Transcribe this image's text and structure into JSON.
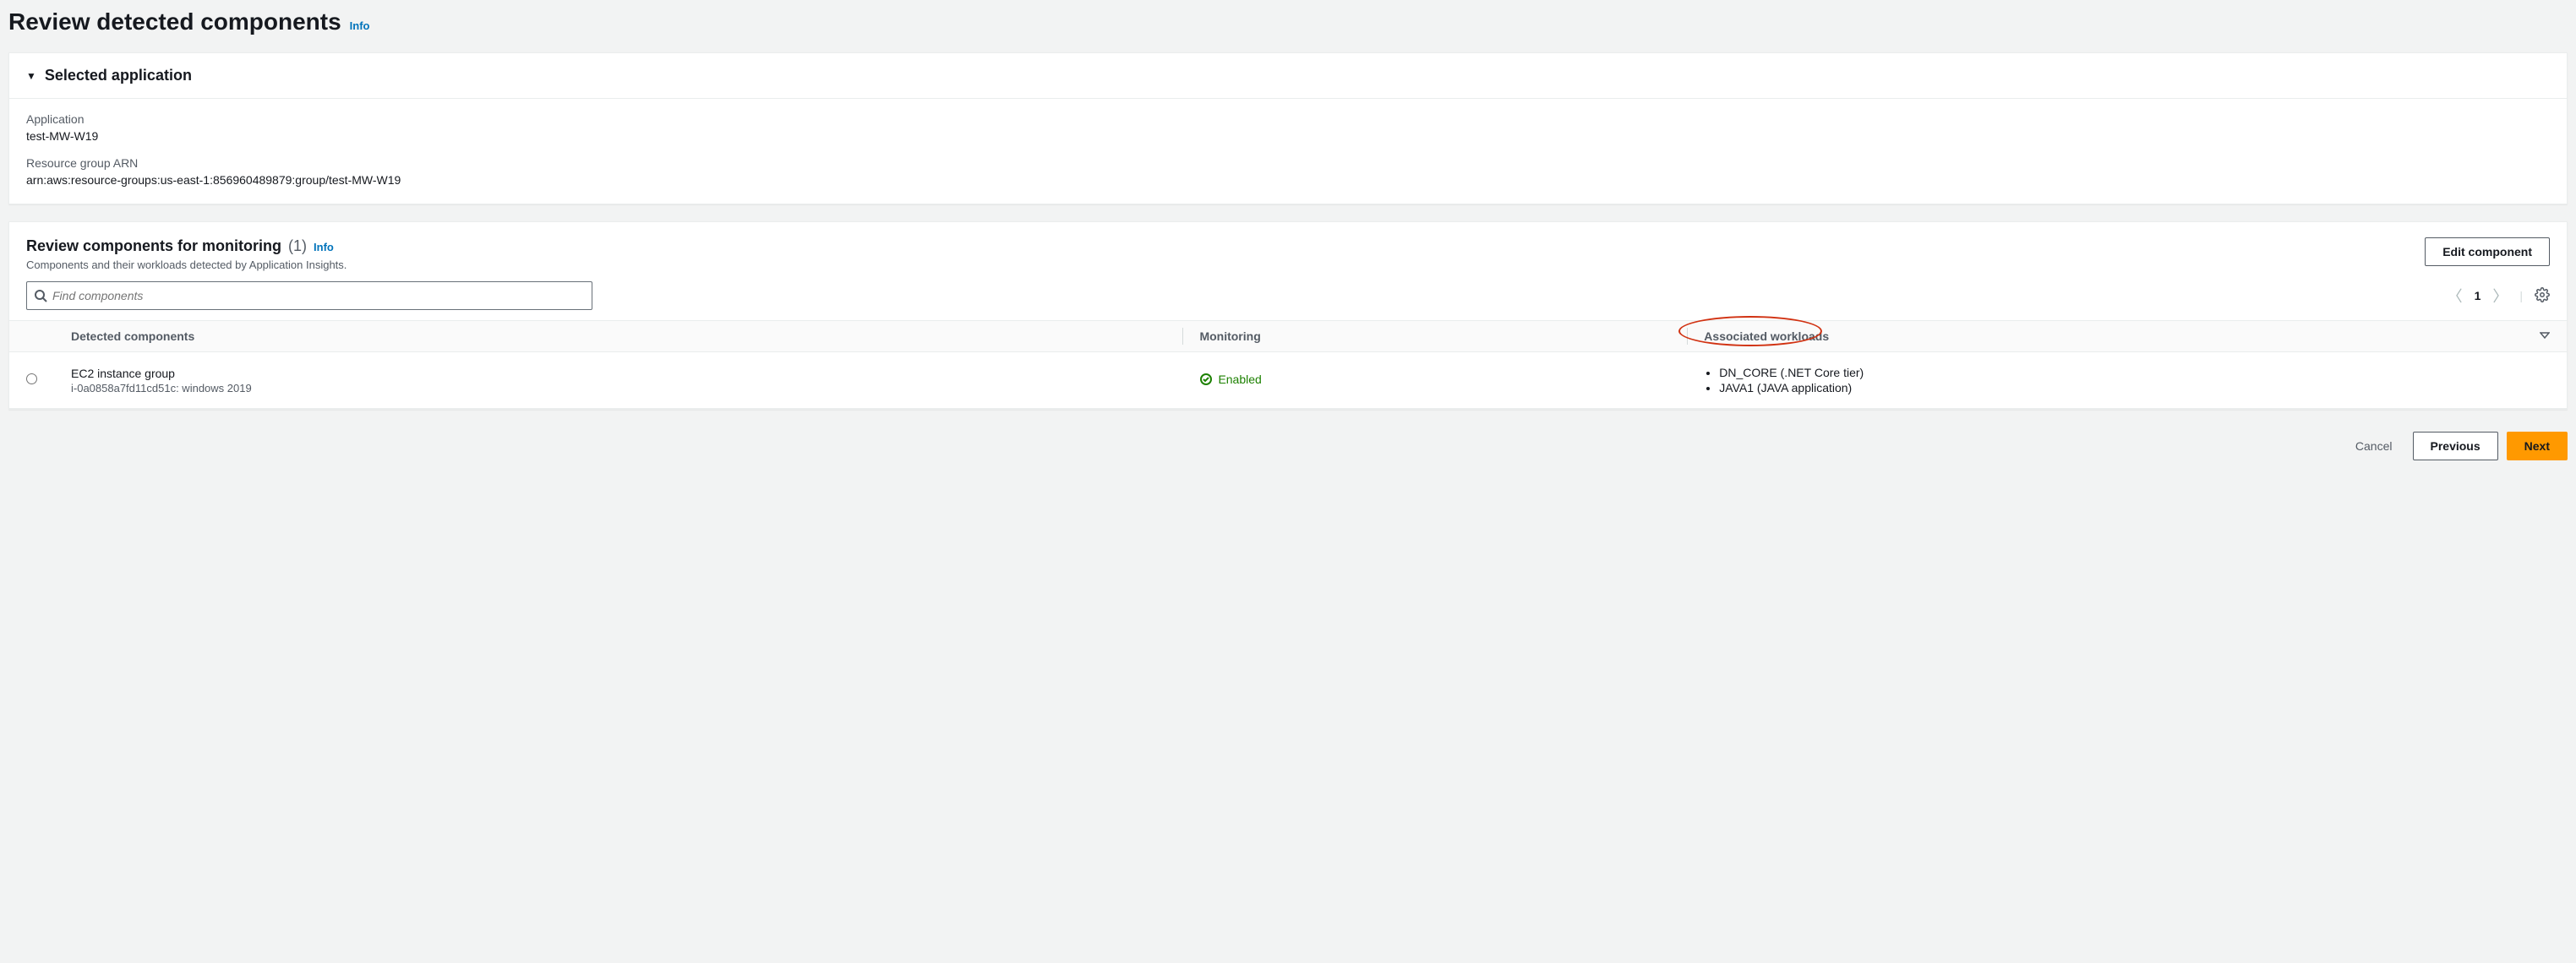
{
  "page": {
    "title": "Review detected components",
    "info_label": "Info"
  },
  "selected_app_panel": {
    "title": "Selected application",
    "application_label": "Application",
    "application_value": "test-MW-W19",
    "arn_label": "Resource group ARN",
    "arn_value": "arn:aws:resource-groups:us-east-1:856960489879:group/test-MW-W19"
  },
  "review_panel": {
    "title": "Review components for monitoring",
    "count": "(1)",
    "info_label": "Info",
    "description": "Components and their workloads detected by Application Insights.",
    "edit_button": "Edit component",
    "search_placeholder": "Find components",
    "page_number": "1",
    "columns": {
      "detected": "Detected components",
      "monitoring": "Monitoring",
      "workloads": "Associated workloads"
    },
    "row": {
      "name": "EC2 instance group",
      "sub": "i-0a0858a7fd11cd51c: windows 2019",
      "monitoring_status": "Enabled",
      "workloads": [
        "DN_CORE (.NET Core tier)",
        "JAVA1 (JAVA application)"
      ]
    }
  },
  "footer": {
    "cancel": "Cancel",
    "previous": "Previous",
    "next": "Next"
  }
}
